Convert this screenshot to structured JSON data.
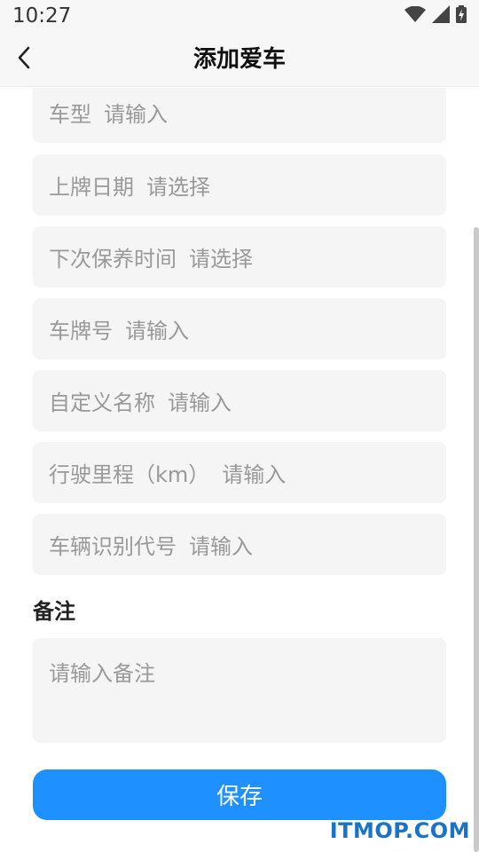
{
  "status_bar": {
    "time": "10:27",
    "icons": [
      "wifi-icon",
      "signal-icon",
      "battery-charging-icon"
    ]
  },
  "header": {
    "back_icon": "chevron-left-icon",
    "title": "添加爱车"
  },
  "form": {
    "fields": [
      {
        "label": "车型",
        "placeholder": "请输入"
      },
      {
        "label": "上牌日期",
        "placeholder": "请选择"
      },
      {
        "label": "下次保养时间",
        "placeholder": "请选择"
      },
      {
        "label": "车牌号",
        "placeholder": "请输入"
      },
      {
        "label": "自定义名称",
        "placeholder": "请输入"
      },
      {
        "label": "行驶里程（km）",
        "placeholder": "请输入"
      },
      {
        "label": "车辆识别代号",
        "placeholder": "请输入"
      }
    ],
    "remark_label": "备注",
    "remark_placeholder": "请输入备注",
    "save_label": "保存"
  },
  "watermark": "ITMOP.COM",
  "colors": {
    "accent": "#1e90ff",
    "field_bg": "#f5f5f5",
    "placeholder": "#999999"
  }
}
